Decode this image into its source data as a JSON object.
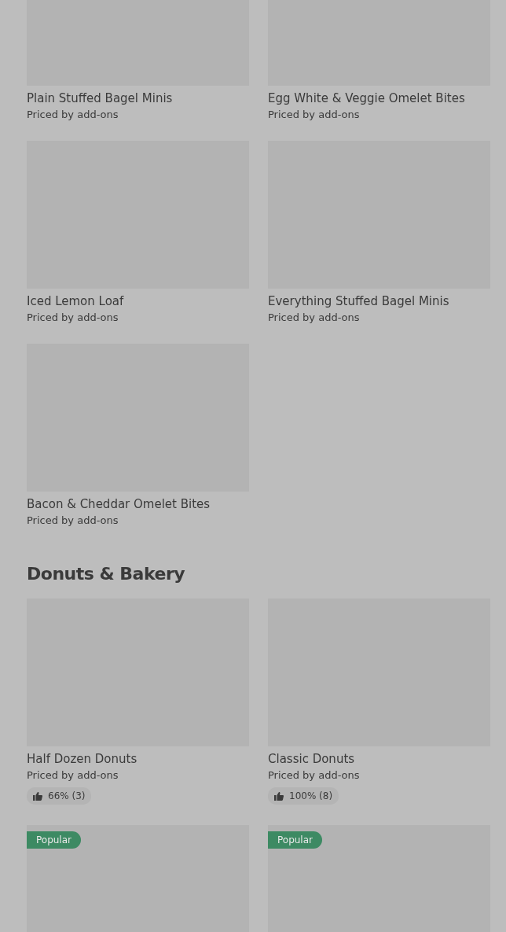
{
  "sections": [
    {
      "items": [
        {
          "name": "Plain Stuffed Bagel Minis",
          "subtitle": "Priced by add-ons"
        },
        {
          "name": "Egg White & Veggie Omelet Bites",
          "subtitle": "Priced by add-ons"
        },
        {
          "name": "Iced Lemon Loaf",
          "subtitle": "Priced by add-ons"
        },
        {
          "name": "Everything Stuffed Bagel Minis",
          "subtitle": "Priced by add-ons"
        },
        {
          "name": "Bacon & Cheddar Omelet Bites",
          "subtitle": "Priced by add-ons"
        }
      ]
    },
    {
      "title": "Donuts & Bakery",
      "items": [
        {
          "name": "Half Dozen Donuts",
          "subtitle": "Priced by add-ons",
          "rating": "66% (3)"
        },
        {
          "name": "Classic Donuts",
          "subtitle": "Priced by add-ons",
          "rating": "100% (8)"
        },
        {
          "badge": "Popular"
        },
        {
          "badge": "Popular"
        }
      ]
    }
  ]
}
